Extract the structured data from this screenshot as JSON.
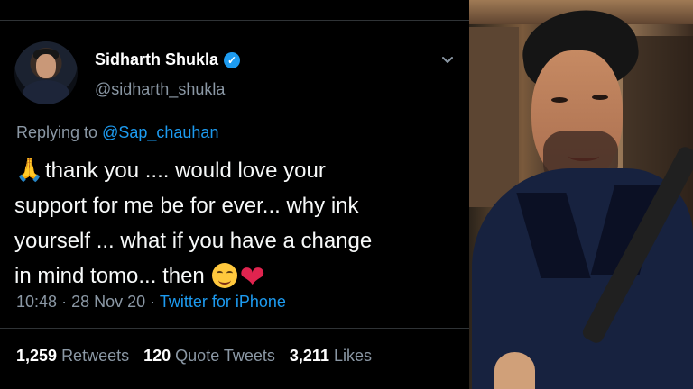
{
  "tweet": {
    "author": {
      "name": "Sidharth Shukla",
      "handle": "@sidharth_shukla",
      "verified_icon": "verified-badge-icon"
    },
    "reply": {
      "prefix": "Replying to",
      "mention": "@Sap_chauhan"
    },
    "body": {
      "line1": "thank you .... would love your",
      "line2": "support for me be for ever... why ink",
      "line3": "yourself ... what if you have a change",
      "line4": "in mind tomo... then"
    },
    "emojis": {
      "hands": "🙏",
      "heart": "❤"
    },
    "meta": {
      "time": "10:48",
      "separator1": "·",
      "date": "28 Nov 20",
      "separator2": "·",
      "source": "Twitter for iPhone"
    },
    "stats": {
      "retweets_count": "1,259",
      "retweets_label": "Retweets",
      "quote_count": "120",
      "quote_label": "Quote Tweets",
      "likes_count": "3,211",
      "likes_label": "Likes"
    },
    "colors": {
      "accent": "#1d9bf0",
      "background": "#000000",
      "secondary_text": "#8b98a5"
    }
  },
  "photo": {
    "icon": "portrait-photo"
  }
}
